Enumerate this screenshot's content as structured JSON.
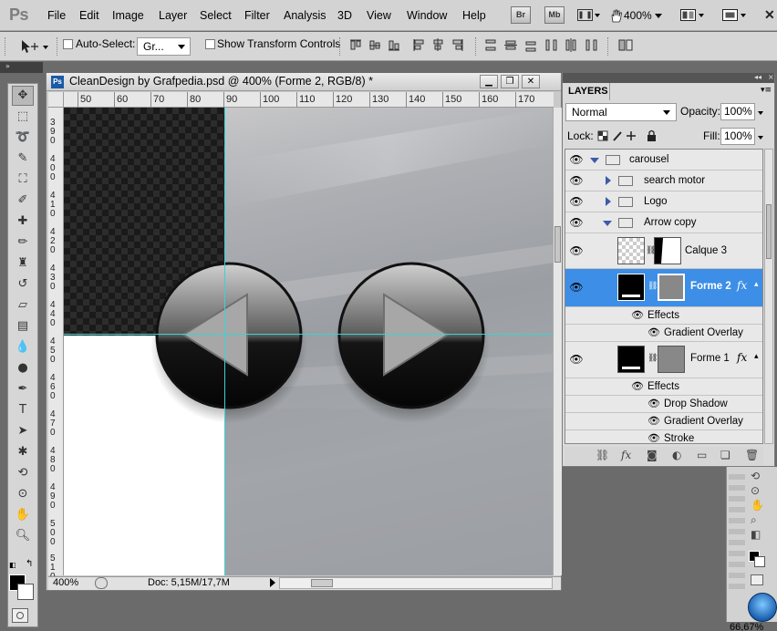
{
  "app": {
    "logo": "Ps"
  },
  "menubar": {
    "items": [
      "File",
      "Edit",
      "Image",
      "Layer",
      "Select",
      "Filter",
      "Analysis",
      "3D",
      "View",
      "Window",
      "Help"
    ],
    "bridge_label": "Br",
    "minibridge_label": "Mb",
    "zoom": "400%"
  },
  "options": {
    "auto_select_label": "Auto-Select:",
    "auto_select_value": "Gr...",
    "transform_label": "Show Transform Controls"
  },
  "document": {
    "ps_badge": "Ps",
    "title": "CleanDesign by Grafpedia.psd @ 400% (Forme 2, RGB/8) *",
    "ruler_h": [
      "50",
      "60",
      "70",
      "80",
      "90",
      "100",
      "110",
      "120",
      "130",
      "140",
      "150",
      "160",
      "170"
    ],
    "ruler_v": [
      [
        "3",
        "9",
        "0"
      ],
      [
        "4",
        "0",
        "0"
      ],
      [
        "4",
        "1",
        "0"
      ],
      [
        "4",
        "2",
        "0"
      ],
      [
        "4",
        "3",
        "0"
      ],
      [
        "4",
        "4",
        "0"
      ],
      [
        "4",
        "5",
        "0"
      ],
      [
        "4",
        "6",
        "0"
      ],
      [
        "4",
        "7",
        "0"
      ],
      [
        "4",
        "8",
        "0"
      ],
      [
        "4",
        "9",
        "0"
      ],
      [
        "5",
        "0",
        "0"
      ],
      [
        "5",
        "1",
        "0"
      ]
    ],
    "zoom": "400%",
    "status": "Doc: 5,15M/17,7M"
  },
  "layers": {
    "tab": "LAYERS",
    "blend_mode": "Normal",
    "opacity_label": "Opacity:",
    "opacity": "100%",
    "lock_label": "Lock:",
    "fill_label": "Fill:",
    "fill": "100%",
    "rows": [
      {
        "name": "carousel",
        "kind": "group-open"
      },
      {
        "name": "search motor",
        "kind": "group-closed"
      },
      {
        "name": "Logo",
        "kind": "group-closed"
      },
      {
        "name": "Arrow copy",
        "kind": "group-open"
      },
      {
        "name": "Calque 3",
        "kind": "layer"
      },
      {
        "name": "Forme 2",
        "kind": "shape",
        "selected": true
      },
      {
        "name": "Effects",
        "kind": "effects"
      },
      {
        "name": "Gradient Overlay",
        "kind": "effect"
      },
      {
        "name": "Forme 1",
        "kind": "shape"
      },
      {
        "name": "Effects",
        "kind": "effects"
      },
      {
        "name": "Drop Shadow",
        "kind": "effect"
      },
      {
        "name": "Gradient Overlay",
        "kind": "effect"
      },
      {
        "name": "Stroke",
        "kind": "effect"
      }
    ],
    "fx_label": "fx"
  },
  "status": {
    "corner_zoom": "66,67%"
  },
  "colors": {
    "selection": "#3d8ee6",
    "guide": "#38d4d4",
    "ps_blue": "#1a5aa6"
  }
}
